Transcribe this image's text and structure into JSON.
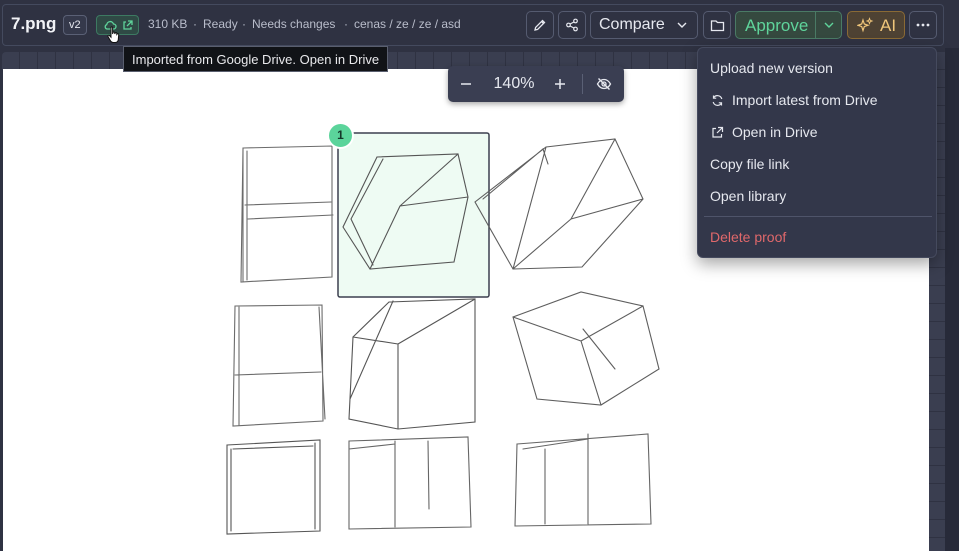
{
  "file": {
    "name": "7.png",
    "version": "v2",
    "size": "310 KB",
    "status": "Ready",
    "review_state": "Needs changes",
    "path": "cenas / ze / ze / asd"
  },
  "separators": {
    "dot": "·"
  },
  "drive_tooltip": "Imported from Google Drive. Open in Drive",
  "toolbar": {
    "compare_label": "Compare",
    "approve_label": "Approve",
    "ai_label": "AI"
  },
  "zoom": {
    "value": "140%"
  },
  "annotation": {
    "pin_number": "1"
  },
  "menu": {
    "items": [
      {
        "label": "Upload new version",
        "icon": ""
      },
      {
        "label": "Import latest from Drive",
        "icon": "refresh-icon"
      },
      {
        "label": "Open in Drive",
        "icon": "external-link-icon"
      },
      {
        "label": "Copy file link",
        "icon": ""
      },
      {
        "label": "Open library",
        "icon": ""
      }
    ],
    "danger_item": {
      "label": "Delete proof"
    }
  },
  "colors": {
    "accent_green": "#5fd49b",
    "danger": "#e0686b",
    "ai_gold": "#f0c67a",
    "selection_fill": "#eefbf3"
  }
}
